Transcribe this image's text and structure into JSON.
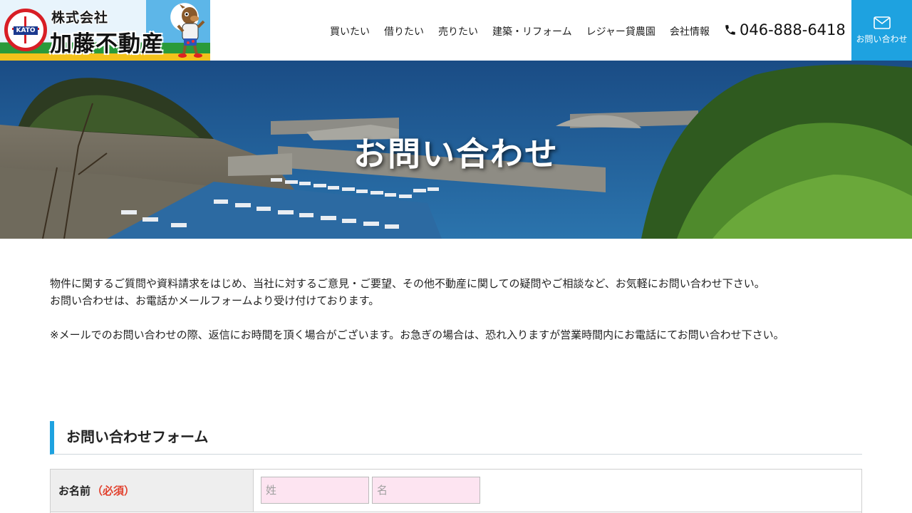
{
  "header": {
    "logo": {
      "emblem_text": "KATO",
      "company_type": "株式会社",
      "company_name": "加藤不動産"
    },
    "nav": [
      {
        "label": "買いたい"
      },
      {
        "label": "借りたい"
      },
      {
        "label": "売りたい"
      },
      {
        "label": "建築・リフォーム"
      },
      {
        "label": "レジャー貸農園"
      },
      {
        "label": "会社情報"
      }
    ],
    "phone": {
      "icon": "phone-icon",
      "number": "046-888-6418"
    },
    "contact_button": {
      "icon": "mail-icon",
      "label": "お問い合わせ"
    },
    "accent_color": "#1ea2e0"
  },
  "hero": {
    "title": "お問い合わせ"
  },
  "intro": {
    "line1": "物件に関するご質問や資料請求をはじめ、当社に対するご意見・ご要望、その他不動産に関しての疑問やご相談など、お気軽にお問い合わせ下さい。",
    "line2": "お問い合わせは、お電話かメールフォームより受け付けております。",
    "note": "※メールでのお問い合わせの際、返信にお時間を頂く場合がございます。お急ぎの場合は、恐れ入りますが営業時間内にお電話にてお問い合わせ下さい。"
  },
  "form": {
    "heading": "お問い合わせフォーム",
    "rows": [
      {
        "label": "お名前",
        "required": "（必須）",
        "last_name_placeholder": "姓",
        "first_name_placeholder": "名",
        "last_name_value": "",
        "first_name_value": ""
      }
    ],
    "required_color": "#e2412e",
    "input_bg_color": "#fde4f1"
  }
}
